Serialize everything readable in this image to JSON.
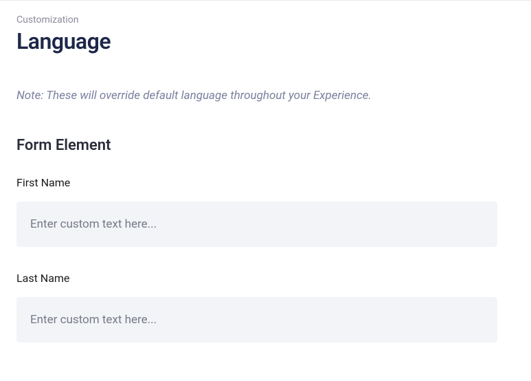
{
  "breadcrumb": "Customization",
  "page_title": "Language",
  "note": "Note: These will override default language throughout your Experience.",
  "section": {
    "title": "Form Element",
    "fields": [
      {
        "label": "First Name",
        "placeholder": "Enter custom text here...",
        "value": ""
      },
      {
        "label": "Last Name",
        "placeholder": "Enter custom text here...",
        "value": ""
      }
    ]
  }
}
